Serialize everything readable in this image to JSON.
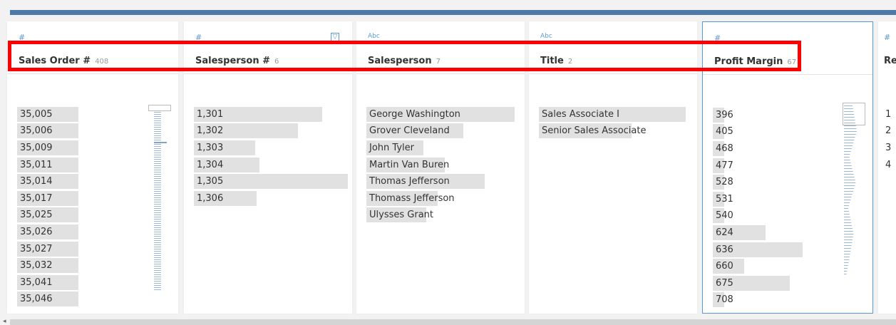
{
  "columns": [
    {
      "type_icon": "#",
      "name": "Sales Order #",
      "count": "408",
      "values": [
        "35,005",
        "35,006",
        "35,009",
        "35,011",
        "35,014",
        "35,017",
        "35,025",
        "35,026",
        "35,027",
        "35,032",
        "35,041",
        "35,046"
      ]
    },
    {
      "type_icon": "#",
      "name": "Salesperson #",
      "count": "6",
      "filter_icon": "filter-icon",
      "values": [
        "1,301",
        "1,302",
        "1,303",
        "1,304",
        "1,305",
        "1,306"
      ]
    },
    {
      "type_icon": "Abc",
      "name": "Salesperson",
      "count": "7",
      "values": [
        "George Washington",
        "Grover Cleveland",
        "John Tyler",
        "Martin Van Buren",
        "Thomas Jefferson",
        "Thomass Jefferson",
        "Ulysses Grant"
      ]
    },
    {
      "type_icon": "Abc",
      "name": "Title",
      "count": "2",
      "values": [
        "Sales Associate I",
        "Senior Sales Associate"
      ]
    },
    {
      "type_icon": "#",
      "name": "Profit Margin",
      "count": "67",
      "values": [
        "396",
        "405",
        "468",
        "477",
        "528",
        "531",
        "540",
        "624",
        "636",
        "660",
        "675",
        "708"
      ]
    },
    {
      "type_icon": "#",
      "name": "Re",
      "values": [
        "1",
        "2",
        "3",
        "4"
      ]
    }
  ],
  "colors": {
    "accent": "#4e79a7",
    "selected_border": "#5b9bd5",
    "highlight": "#ff0000",
    "value_bar": "#e1e1e1"
  }
}
